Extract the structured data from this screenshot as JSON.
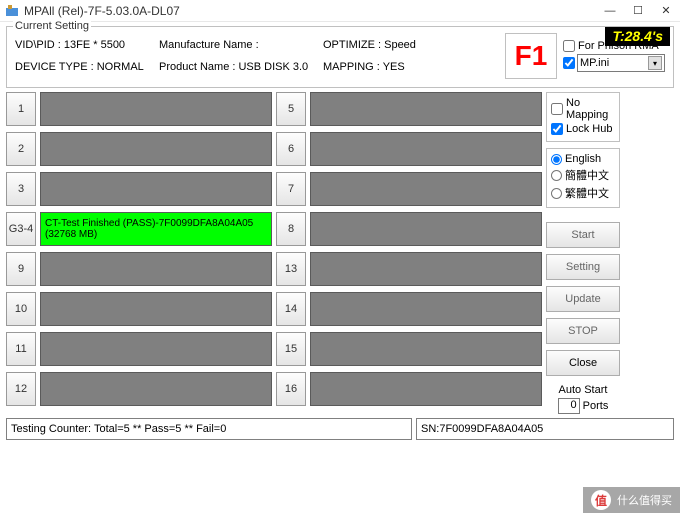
{
  "window": {
    "title": "MPAll (Rel)-7F-5.03.0A-DL07"
  },
  "timer": "T:28.4's",
  "settings": {
    "legend": "Current Setting",
    "vidpid_label": "VID\\PID : 13FE * 5500",
    "device_type": "DEVICE TYPE : NORMAL",
    "manuf_name": "Manufacture Name :",
    "product_name": "Product Name : USB DISK 3.0",
    "optimize": "OPTIMIZE : Speed",
    "mapping": "MAPPING : YES",
    "f1": "F1",
    "for_phison": "For Phison RMA",
    "mpini": "MP.ini"
  },
  "side": {
    "no_mapping": "No Mapping",
    "lock_hub": "Lock Hub",
    "lang_en": "English",
    "lang_sc": "簡體中文",
    "lang_tc": "繁體中文"
  },
  "buttons": {
    "start": "Start",
    "setting": "Setting",
    "update": "Update",
    "stop": "STOP",
    "close": "Close",
    "auto_start": "Auto Start",
    "ports": "Ports",
    "ports_val": "0"
  },
  "slots_left": [
    {
      "n": "1",
      "txt": "",
      "pass": false
    },
    {
      "n": "2",
      "txt": "",
      "pass": false
    },
    {
      "n": "3",
      "txt": "",
      "pass": false
    },
    {
      "n": "G3-4",
      "txt": "CT-Test Finished (PASS)-7F0099DFA8A04A05 (32768 MB)",
      "pass": true
    },
    {
      "n": "9",
      "txt": "",
      "pass": false
    },
    {
      "n": "10",
      "txt": "",
      "pass": false
    },
    {
      "n": "11",
      "txt": "",
      "pass": false
    },
    {
      "n": "12",
      "txt": "",
      "pass": false
    }
  ],
  "slots_right": [
    {
      "n": "5",
      "txt": "",
      "pass": false
    },
    {
      "n": "6",
      "txt": "",
      "pass": false
    },
    {
      "n": "7",
      "txt": "",
      "pass": false
    },
    {
      "n": "8",
      "txt": "",
      "pass": false
    },
    {
      "n": "13",
      "txt": "",
      "pass": false
    },
    {
      "n": "14",
      "txt": "",
      "pass": false
    },
    {
      "n": "15",
      "txt": "",
      "pass": false
    },
    {
      "n": "16",
      "txt": "",
      "pass": false
    }
  ],
  "status": {
    "counter": "Testing Counter: Total=5 ** Pass=5 ** Fail=0",
    "sn": "SN:7F0099DFA8A04A05"
  },
  "watermark": "什么值得买"
}
